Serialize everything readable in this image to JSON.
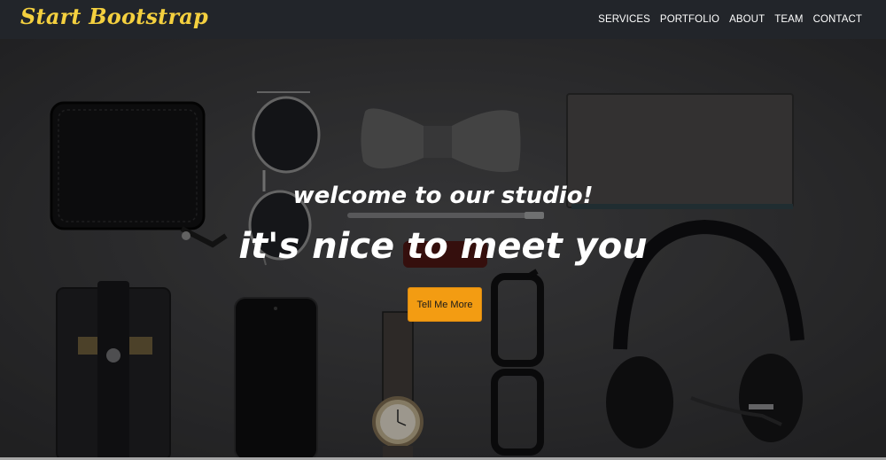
{
  "navbar": {
    "brand": "Start Bootstrap",
    "links": [
      "SERVICES",
      "PORTFOLIO",
      "ABOUT",
      "TEAM",
      "CONTACT"
    ]
  },
  "hero": {
    "lead": "welcome to our studio!",
    "heading": "it's nice to meet you",
    "button": "Tell Me More"
  },
  "colors": {
    "brand": "#f4d03f",
    "button": "#f39c12",
    "navbar": "#22252a"
  }
}
